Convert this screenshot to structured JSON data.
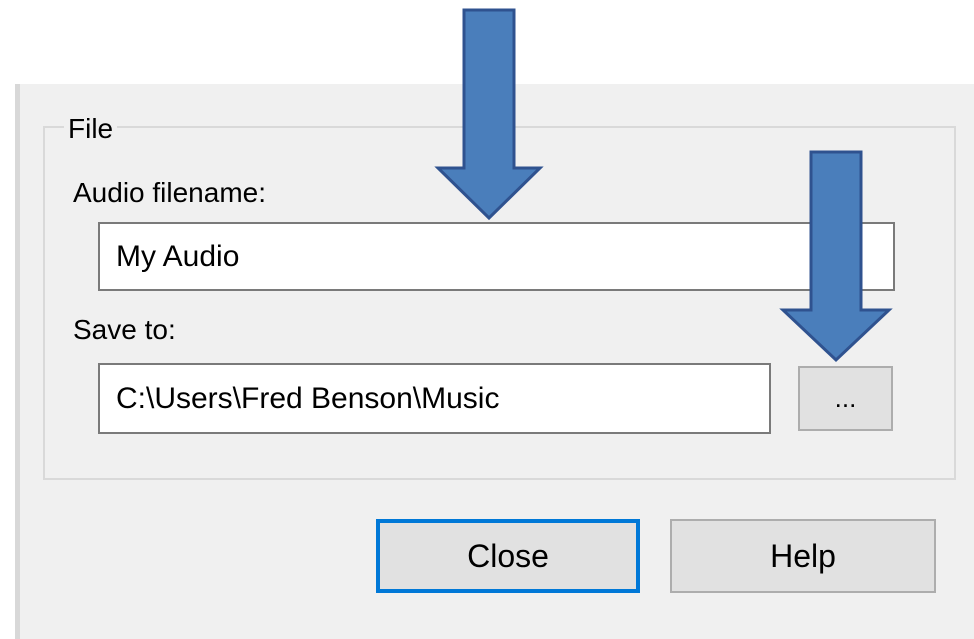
{
  "file_group": {
    "legend": "File",
    "audio_filename_label": "Audio filename:",
    "audio_filename_value": "My Audio",
    "save_to_label": "Save to:",
    "save_to_value": "C:\\Users\\Fred Benson\\Music",
    "browse_label": "..."
  },
  "buttons": {
    "close_label": "Close",
    "help_label": "Help"
  },
  "annotations": {
    "arrow_color": "#4a7ebb",
    "arrow_outline": "#2f528f",
    "icons": [
      "down-arrow-icon",
      "down-arrow-icon"
    ]
  },
  "colors": {
    "dialog_bg": "#f0f0f0",
    "focus_border": "#0078d7"
  }
}
